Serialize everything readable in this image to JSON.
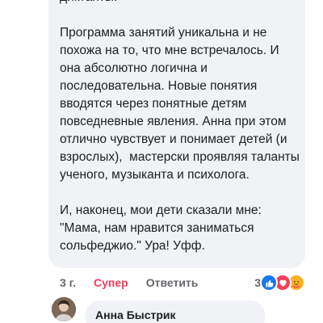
{
  "comment": {
    "text": "диктанты.\n\nПрограмма занятий уникальна и не похожа на то, что мне встречалось. И она абсолютно логична и последовательна. Новые понятия вводятся через понятные детям повседневные явления. Анна при этом отлично чувствует и понимает детей (и взрослых),  мастерски проявляя таланты ученого, музыканта и психолога.\n\nИ, наконец, мои дети сказали мне: \"Мама, нам нравится заниматься сольфеджио.\" Ура! Уфф.",
    "time": "3 г.",
    "like_label": "Супер",
    "reply_label": "Ответить",
    "reaction_count": "3",
    "reactions": [
      "like-icon",
      "love-icon",
      "care-icon"
    ],
    "colors": {
      "like": "#1877f2",
      "love": "#f33e58",
      "care": "#f7b125",
      "bubble": "#f0f2f5"
    }
  },
  "reply": {
    "author": "Анна Быстрик"
  }
}
